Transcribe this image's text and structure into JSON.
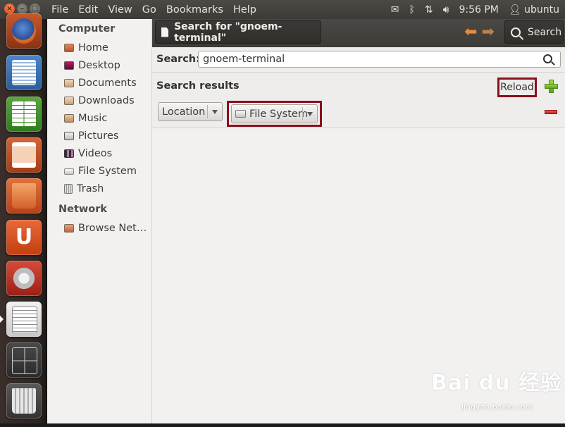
{
  "menu": [
    "File",
    "Edit",
    "View",
    "Go",
    "Bookmarks",
    "Help"
  ],
  "panel": {
    "time": "9:56 PM",
    "user": "ubuntu"
  },
  "sidebar": {
    "computer_header": "Computer",
    "computer_items": [
      {
        "label": "Home",
        "icon": "home-folder-icon"
      },
      {
        "label": "Desktop",
        "icon": "desktop-icon"
      },
      {
        "label": "Documents",
        "icon": "documents-folder-icon"
      },
      {
        "label": "Downloads",
        "icon": "downloads-folder-icon"
      },
      {
        "label": "Music",
        "icon": "music-folder-icon"
      },
      {
        "label": "Pictures",
        "icon": "pictures-folder-icon"
      },
      {
        "label": "Videos",
        "icon": "videos-folder-icon"
      },
      {
        "label": "File System",
        "icon": "drive-icon"
      },
      {
        "label": "Trash",
        "icon": "trash-icon"
      }
    ],
    "network_header": "Network",
    "network_items": [
      {
        "label": "Browse Net…",
        "icon": "network-folder-icon"
      }
    ]
  },
  "toolbar": {
    "title": "Search for \"gnoem-terminal\"",
    "search_label": "Search"
  },
  "search": {
    "label": "Search:",
    "query": "gnoem-terminal",
    "results_label": "Search results",
    "reload_label": "Reload",
    "criterion_label": "Location",
    "location_value": "File System"
  },
  "watermark": {
    "main": "Bai du 经验",
    "sub": "jingyan.baidu.com"
  },
  "colors": {
    "accent": "#dd4814",
    "highlight_box": "#8b0f1c",
    "panel": "#3c3b37"
  }
}
